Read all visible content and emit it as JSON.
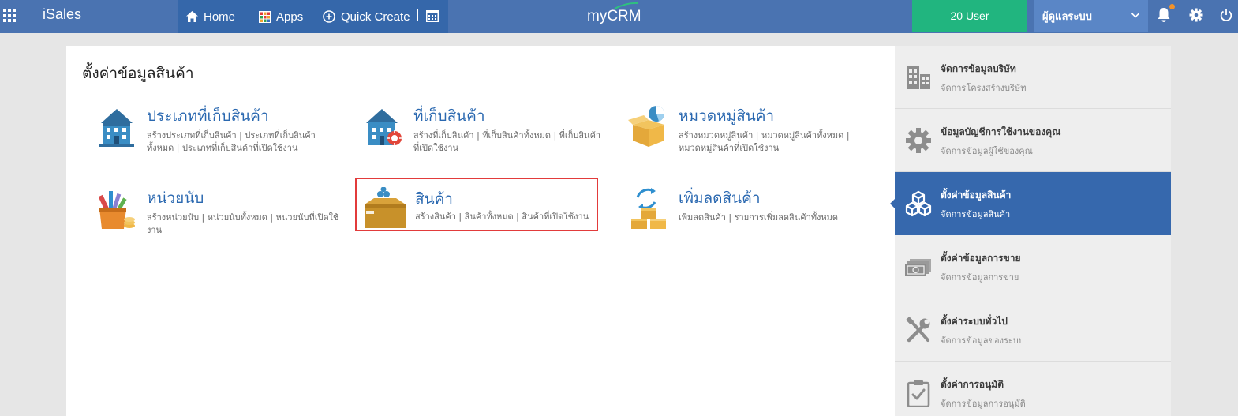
{
  "header": {
    "brand": "iSales",
    "nav": [
      {
        "label": "Home",
        "icon": "home-icon"
      },
      {
        "label": "Apps",
        "icon": "apps-grid-icon"
      },
      {
        "label": "Quick Create",
        "icon": "plus-circle-icon"
      }
    ],
    "logo": "myCRM",
    "user_count": "20 User",
    "role": "ผู้ดูแลระบบ",
    "icons": [
      "grid-menu-icon",
      "calendar-icon",
      "bell-icon",
      "gear-icon",
      "power-icon"
    ],
    "colors": {
      "bar": "#4a73b1",
      "nav_strip": "#3567aa",
      "user_badge": "#21b57f",
      "role_select": "#5a86c6",
      "notification_dot": "#f0922b"
    }
  },
  "main": {
    "title": "ตั้งค่าข้อมูลสินค้า",
    "cards": [
      {
        "title": "ประเภทที่เก็บสินค้า",
        "desc": "สร้างประเภทที่เก็บสินค้า | ประเภทที่เก็บสินค้าทั้งหมด | ประเภทที่เก็บสินค้าที่เปิดใช้งาน",
        "icon": "building-icon"
      },
      {
        "title": "ที่เก็บสินค้า",
        "desc": "สร้างที่เก็บสินค้า | ที่เก็บสินค้าทั้งหมด | ที่เก็บสินค้าที่เปิดใช้งาน",
        "icon": "warehouse-location-icon"
      },
      {
        "title": "หมวดหมู่สินค้า",
        "desc": "สร้างหมวดหมู่สินค้า | หมวดหมู่สินค้าทั้งหมด | หมวดหมู่สินค้าที่เปิดใช้งาน",
        "icon": "open-box-chart-icon"
      },
      {
        "title": "หน่วยนับ",
        "desc": "สร้างหน่วยนับ | หน่วยนับทั้งหมด | หน่วยนับที่เปิดใช้งาน",
        "icon": "measure-tools-icon"
      },
      {
        "title": "สินค้า",
        "desc": "สร้างสินค้า | สินค้าทั้งหมด | สินค้าที่เปิดใช้งาน",
        "icon": "product-box-icon"
      },
      {
        "title": "เพิ่มลดสินค้า",
        "desc": "เพิ่มลดสินค้า | รายการเพิ่มลดสินค้าทั้งหมด",
        "icon": "boxes-exchange-icon"
      }
    ],
    "selected_card": "สินค้า",
    "colors": {
      "card_title": "#2a68b0",
      "selection_border": "#e23b3b"
    }
  },
  "sidebar": {
    "items": [
      {
        "title": "จัดการข้อมูลบริษัท",
        "sub": "จัดการโครงสร้างบริษัท",
        "icon": "company-building-icon"
      },
      {
        "title": "ข้อมูลบัญชีการใช้งานของคุณ",
        "sub": "จัดการข้อมูลผู้ใช้ของคุณ",
        "icon": "settings-gear-icon"
      },
      {
        "title": "ตั้งค่าข้อมูลสินค้า",
        "sub": "จัดการข้อมูลสินค้า",
        "icon": "cubes-icon"
      },
      {
        "title": "ตั้งค่าข้อมูลการขาย",
        "sub": "จัดการข้อมูลการขาย",
        "icon": "money-bills-icon"
      },
      {
        "title": "ตั้งค่าระบบทั่วไป",
        "sub": "จัดการข้อมูลของระบบ",
        "icon": "tools-icon"
      },
      {
        "title": "ตั้งค่าการอนุมัติ",
        "sub": "จัดการข้อมูลการอนุมัติ",
        "icon": "clipboard-check-icon"
      }
    ],
    "active_item": "ตั้งค่าข้อมูลสินค้า",
    "colors": {
      "active_bg": "#3668ad"
    }
  }
}
